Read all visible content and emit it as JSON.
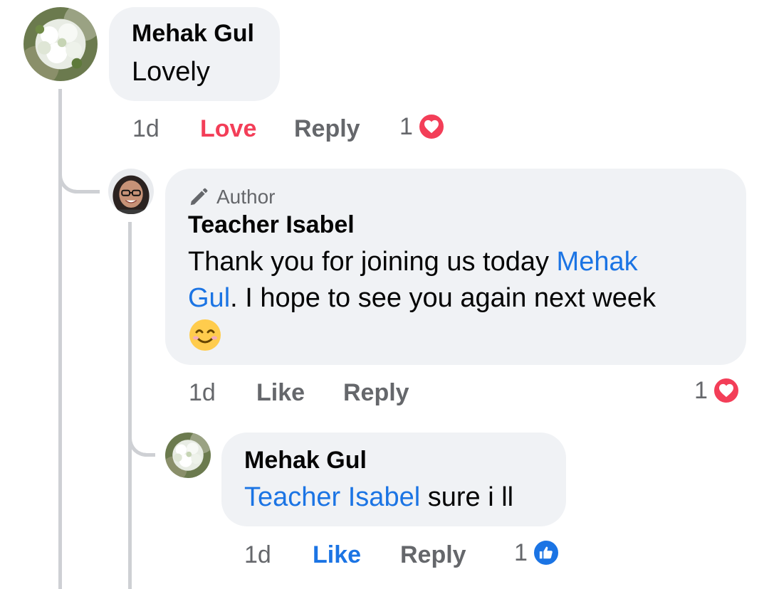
{
  "comments": [
    {
      "author": "Mehak Gul",
      "avatar": "flower-bouquet-avatar",
      "body": "Lovely",
      "time": "1d",
      "reaction_label": "Love",
      "reply_label": "Reply",
      "reaction_count": "1",
      "reaction_icon": "heart-icon",
      "reaction_color": "#f33e58"
    },
    {
      "badge": "Author",
      "badge_icon": "pencil-icon",
      "author": "Teacher Isabel",
      "avatar": "woman-glasses-avatar",
      "body_mention": "Mehak Gul",
      "body_prefix": "Thank you for joining us today",
      "body_mention_part1": "Mehak",
      "body_mention_part2": "Gul",
      "body_suffix": ". I hope to see you again next week",
      "body_emoji": "😊",
      "time": "1d",
      "reaction_label": "Like",
      "reply_label": "Reply",
      "reaction_count": "1",
      "reaction_icon": "heart-icon",
      "reaction_color": "#f33e58"
    },
    {
      "author": "Mehak Gul",
      "avatar": "flower-bouquet-avatar",
      "body_mention": "Teacher Isabel",
      "body_suffix": " sure i ll",
      "time": "1d",
      "reaction_label": "Like",
      "reply_label": "Reply",
      "reaction_count": "1",
      "reaction_icon": "thumbs-up-icon",
      "reaction_color": "#1b74e4"
    }
  ],
  "colors": {
    "bubble": "#f0f2f5",
    "mention": "#1b74e4",
    "muted": "#65676b",
    "love": "#f33e58",
    "like": "#1b74e4"
  }
}
